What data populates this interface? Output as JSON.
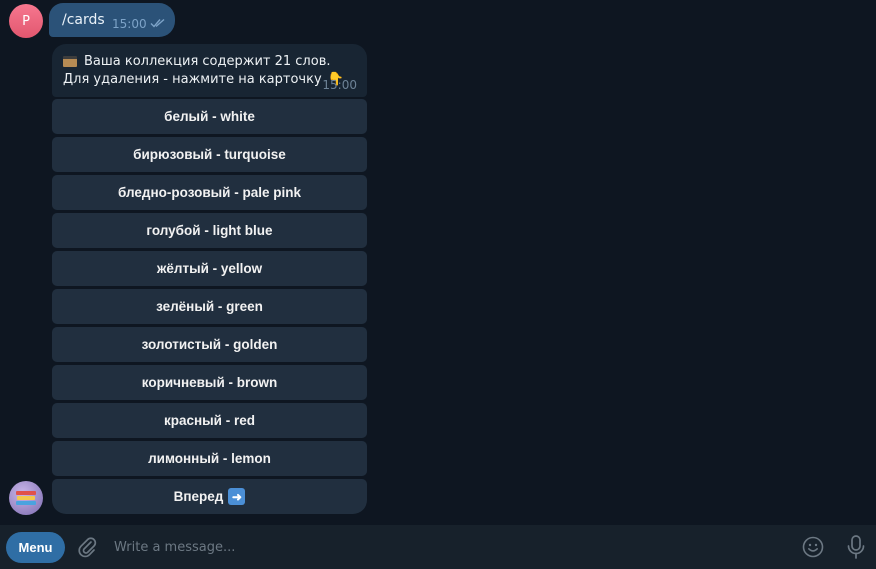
{
  "user_message": {
    "avatar_letter": "P",
    "text": "/cards",
    "time": "15:00"
  },
  "bot_message": {
    "line1": "Ваша коллекция содержит 21 слов.",
    "line2": "Для удаления - нажмите на карточку",
    "time": "15:00"
  },
  "keyboard": {
    "buttons": [
      "белый - white",
      "бирюзовый - turquoise",
      "бледно-розовый - pale pink",
      "голубой - light blue",
      "жёлтый - yellow",
      "зелёный - green",
      "золотистый - golden",
      "коричневый - brown",
      "красный - red",
      "лимонный - lemon"
    ],
    "next_label": "Вперед"
  },
  "composer": {
    "menu_label": "Menu",
    "placeholder": "Write a message..."
  },
  "colors": {
    "background": "#0e1621",
    "outgoing_bubble": "#2b5278",
    "incoming_bubble": "#182533",
    "keyboard_button": "#212f3f",
    "accent": "#2f6ea5"
  }
}
